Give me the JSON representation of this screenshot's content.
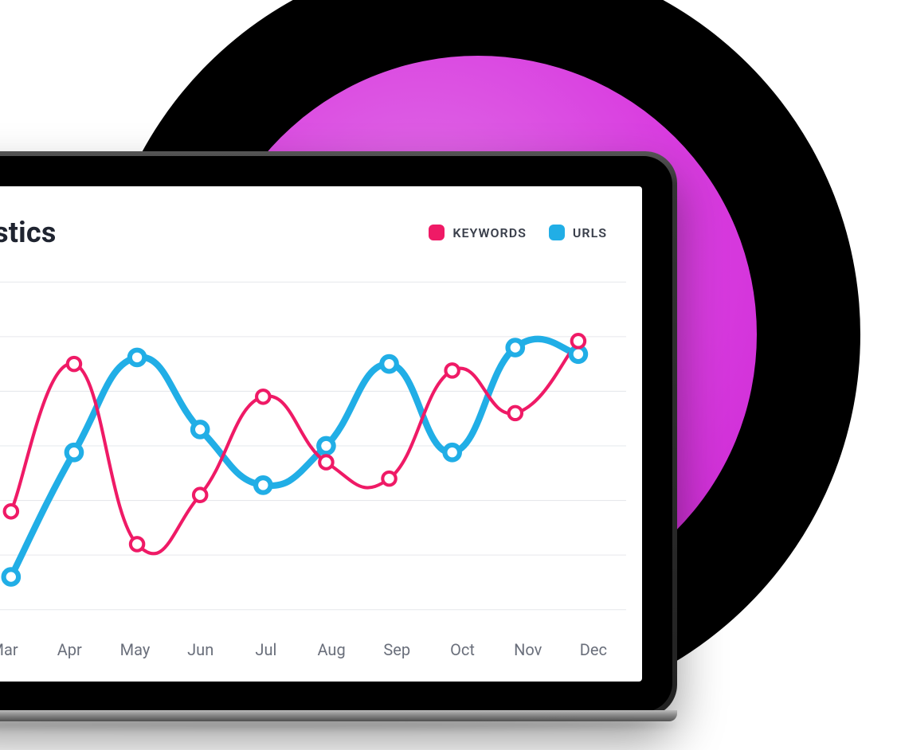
{
  "chart_data": {
    "type": "line",
    "title": "Statistics",
    "categories": [
      "Mar",
      "Apr",
      "May",
      "Jun",
      "Jul",
      "Aug",
      "Sep",
      "Oct",
      "Nov",
      "Dec"
    ],
    "x_index": [
      0,
      1,
      2,
      3,
      4,
      5,
      6,
      7,
      8,
      9
    ],
    "series": [
      {
        "name": "KEYWORDS",
        "color": "#ef1a66",
        "values": [
          30,
          75,
          20,
          35,
          65,
          45,
          40,
          73,
          60,
          82
        ]
      },
      {
        "name": "URLS",
        "color": "#21aee6",
        "values": [
          10,
          48,
          77,
          55,
          38,
          50,
          75,
          48,
          80,
          78
        ]
      }
    ],
    "ylim": [
      0,
      100
    ],
    "grid_lines": 6,
    "legend_position": "top-right",
    "xlabel": "",
    "ylabel": ""
  },
  "header": {
    "title_visible": "tistics"
  },
  "legend": {
    "items": [
      {
        "label": "KEYWORDS"
      },
      {
        "label": "URLS"
      }
    ]
  },
  "xaxis": {
    "ticks": [
      "Mar",
      "Apr",
      "May",
      "Jun",
      "Jul",
      "Aug",
      "Sep",
      "Oct",
      "Nov",
      "Dec"
    ]
  }
}
